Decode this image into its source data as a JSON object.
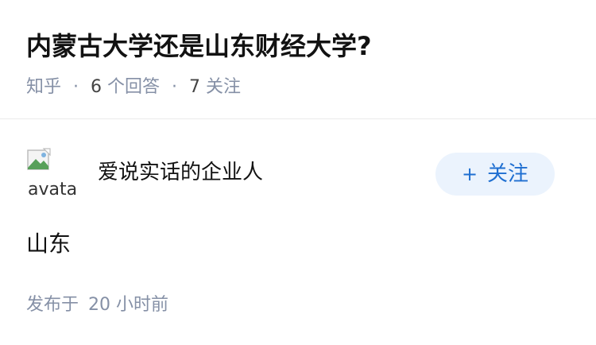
{
  "question": {
    "title": "内蒙古大学还是山东财经大学?",
    "source": "知乎",
    "answer_count": "6",
    "answer_label": "个回答",
    "follow_count": "7",
    "follow_label": "关注",
    "separator": "·"
  },
  "answer": {
    "avatar_alt": "avatar",
    "author": "爱说实话的企业人",
    "follow_button": {
      "plus": "+",
      "label": "关注"
    },
    "content": "山东",
    "published_prefix": "发布于",
    "published_time": "20 小时前"
  },
  "colors": {
    "title": "#121212",
    "meta": "#8590a6",
    "follow_bg": "#ebf3fd",
    "follow_text": "#1f6fd1",
    "divider": "#ebebeb"
  }
}
